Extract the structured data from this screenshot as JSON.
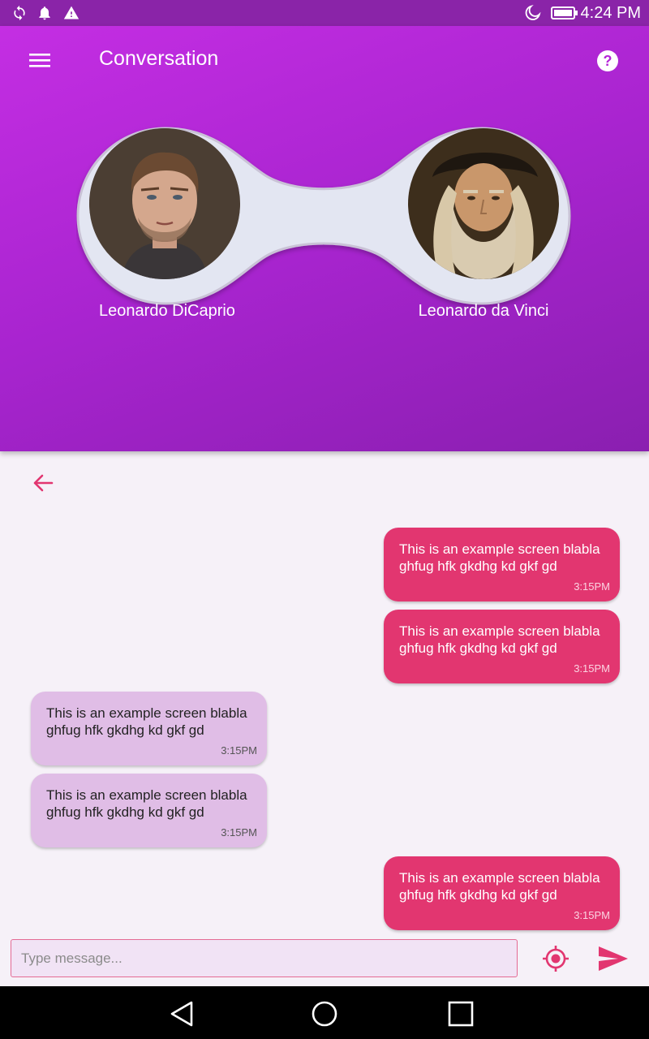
{
  "status_bar": {
    "time": "4:24 PM",
    "icons": [
      "sync-icon",
      "notification-bell-icon",
      "warning-icon",
      "do-not-disturb-moon-icon",
      "battery-icon"
    ]
  },
  "app_bar": {
    "title": "Conversation",
    "menu_icon": "hamburger-menu-icon",
    "help_icon": "help-circle-icon"
  },
  "participants": [
    {
      "name": "Leonardo DiCaprio",
      "avatar": "portrait-photo"
    },
    {
      "name": "Leonardo da Vinci",
      "avatar": "portrait-painting"
    }
  ],
  "messages": [
    {
      "direction": "outgoing",
      "text": "This is an example screen blabla ghfug hfk gkdhg kd gkf gd",
      "time": "3:15PM"
    },
    {
      "direction": "outgoing",
      "text": "This is an example screen blabla ghfug hfk gkdhg kd gkf gd",
      "time": "3:15PM"
    },
    {
      "direction": "incoming",
      "text": "This is an example screen blabla ghfug hfk gkdhg kd gkf gd",
      "time": "3:15PM"
    },
    {
      "direction": "incoming",
      "text": "This is an example screen blabla ghfug hfk gkdhg kd gkf gd",
      "time": "3:15PM"
    },
    {
      "direction": "outgoing",
      "text": "This is an example screen blabla ghfug hfk gkdhg kd gkf gd",
      "time": "3:15PM"
    }
  ],
  "composer": {
    "placeholder": "Type message...",
    "value": ""
  },
  "colors": {
    "accent": "#e23670",
    "header": "#b026d4",
    "incoming_bubble": "#e0bde6",
    "background": "#f6f1f8"
  }
}
